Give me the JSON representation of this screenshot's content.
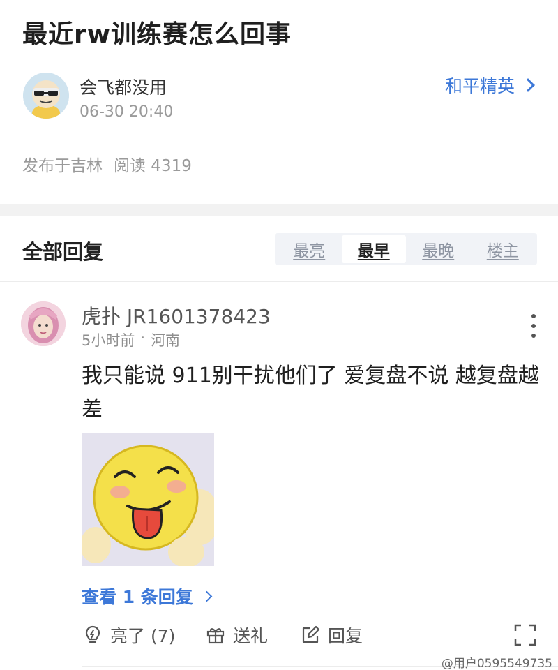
{
  "post": {
    "title": "最近rw训练赛怎么回事",
    "author": "会飞都没用",
    "time": "06-30 20:40",
    "forum": "和平精英",
    "location": "发布于吉林",
    "reads": "阅读 4319"
  },
  "replies_section": {
    "title": "全部回复",
    "tabs": [
      "最亮",
      "最早",
      "最晚",
      "楼主"
    ],
    "active_tab": "最早"
  },
  "reply": {
    "user": "虎扑 JR1601378423",
    "time": "5小时前",
    "dot": "·",
    "region": "河南",
    "content": "我只能说 911别干扰他们了 爱复盘不说 越复盘越差",
    "view_replies": "查看 1 条回复",
    "actions": {
      "like": "亮了 (7)",
      "gift": "送礼",
      "reply": "回复"
    }
  },
  "watermark": "@用户0595549735",
  "colors": {
    "accent": "#3d78d8",
    "muted": "#9a9a9a"
  }
}
